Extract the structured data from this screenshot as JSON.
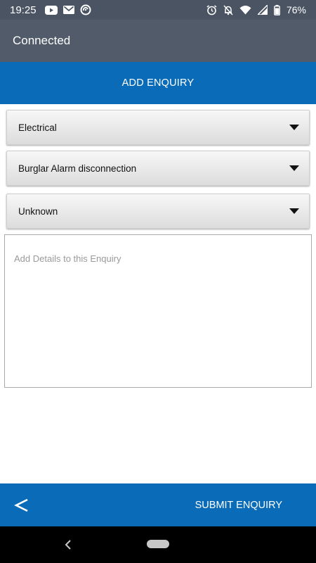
{
  "status_bar": {
    "time": "19:25",
    "battery": "76%",
    "left_icons": [
      "youtube-icon",
      "gmail-icon",
      "sync-icon"
    ],
    "right_icons": [
      "alarm-icon",
      "notifications-off-icon",
      "wifi-icon",
      "signal-icon",
      "battery-icon"
    ]
  },
  "app_bar": {
    "title": "Connected"
  },
  "header": {
    "title": "ADD ENQUIRY"
  },
  "dropdowns": [
    {
      "value": "Electrical"
    },
    {
      "value": "Burglar Alarm disconnection"
    },
    {
      "value": "Unknown"
    }
  ],
  "details": {
    "placeholder": "Add Details to this Enquiry",
    "value": ""
  },
  "bottom_bar": {
    "back_label": "<",
    "submit_label": "SUBMIT ENQUIRY"
  },
  "colors": {
    "primary": "#0a6bb9",
    "app_bar": "#515b69",
    "status_bar": "#4a5462"
  }
}
